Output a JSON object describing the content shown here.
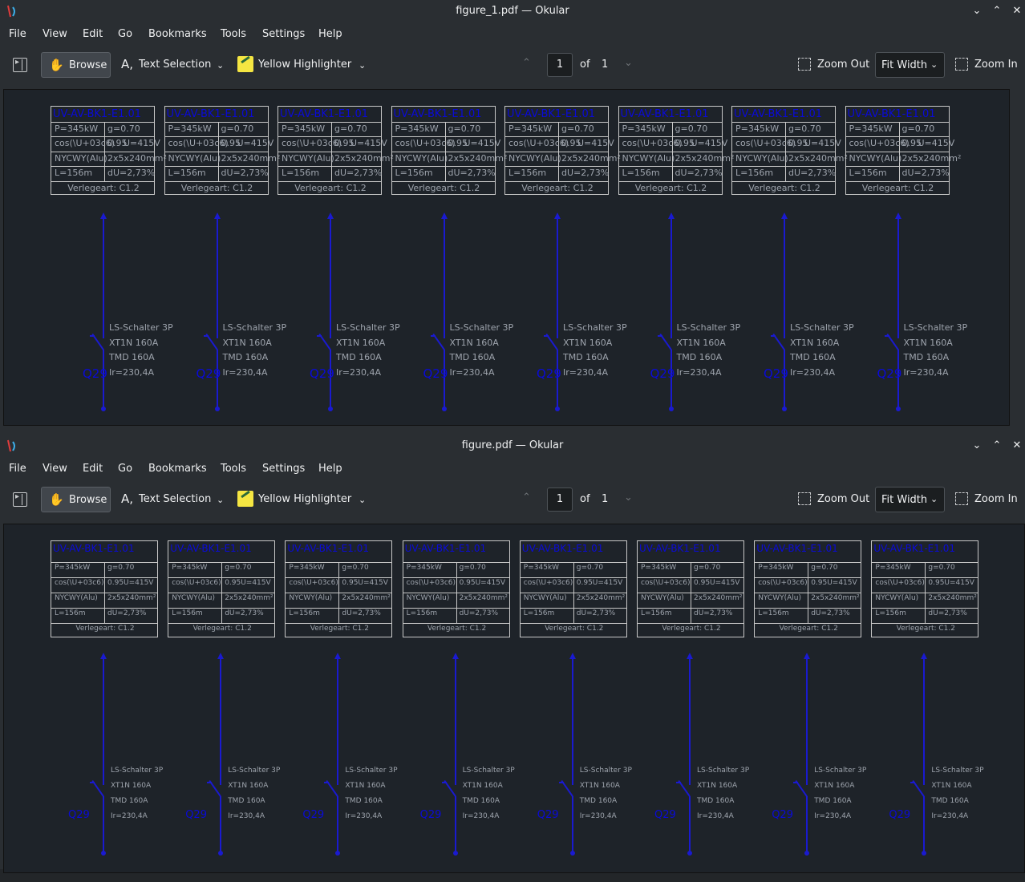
{
  "windows": [
    {
      "id": "win1",
      "title": "figure_1.pdf — Okular",
      "page_current": "1",
      "page_total": "1"
    },
    {
      "id": "win2",
      "title": "figure.pdf — Okular",
      "page_current": "1",
      "page_total": "1"
    }
  ],
  "menu": [
    "File",
    "View",
    "Edit",
    "Go",
    "Bookmarks",
    "Tools",
    "Settings",
    "Help"
  ],
  "toolbar": {
    "browse": "Browse",
    "text_selection": "Text Selection",
    "highlighter": "Yellow Highlighter",
    "of": "of",
    "zoom_out": "Zoom Out",
    "zoom_mode": "Fit Width",
    "zoom_in": "Zoom In"
  },
  "feeder": {
    "name": "UV-AV-BK1-E1.01",
    "power": "P=345kW",
    "g": "g=0.70",
    "cos_label": "cos(\\U+03c6)",
    "cos_value": "0.95",
    "voltage": "U=415V",
    "cable_type": "NYCWY(Alu)",
    "cable_size": "2x5x240mm²",
    "length": "L=156m",
    "du": "dU=2,73%",
    "install": "Verlegeart: C1.2",
    "breaker_type": "LS-Schalter 3P",
    "breaker_model": "XT1N 160A",
    "trip_unit": "TMD 160A",
    "ir": "Ir=230,4A",
    "designation": "Q29"
  },
  "icons": {
    "app": "okular-icon",
    "minimize": "chevron-down-icon",
    "maximize": "chevron-up-icon",
    "close": "close-icon",
    "sidebar": "sidebar-toggle-icon",
    "browse": "hand-icon",
    "text_select": "text-cursor-icon",
    "highlight": "highlighter-icon",
    "prev": "chevron-up-icon",
    "next": "chevron-down-icon",
    "zoom_out": "zoom-out-icon",
    "zoom_in": "zoom-in-icon"
  },
  "colors": {
    "wire": "#1a1ad0",
    "header_text": "#0a0ad8",
    "box_text": "#9ea4ad",
    "background": "#1e2329"
  }
}
